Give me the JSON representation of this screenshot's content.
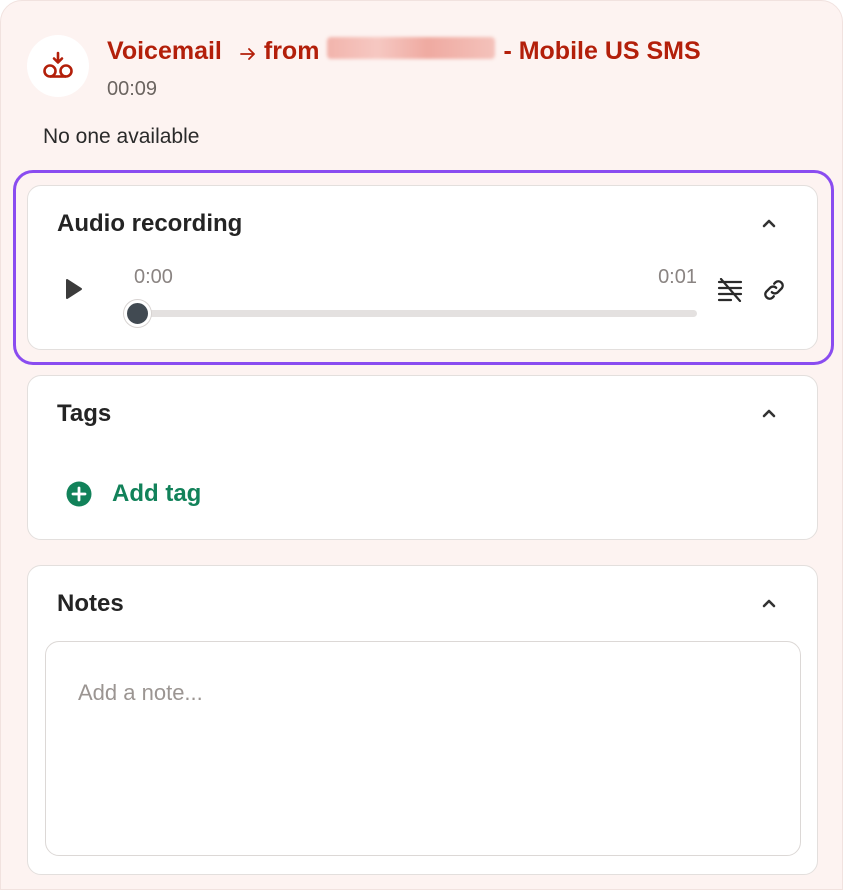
{
  "header": {
    "title": "Voicemail",
    "from_prefix": "from",
    "from_suffix": "- Mobile US SMS",
    "duration": "00:09",
    "status": "No one available"
  },
  "audio": {
    "title": "Audio recording",
    "current_time": "0:00",
    "total_time": "0:01",
    "progress_fraction": 0
  },
  "tags": {
    "title": "Tags",
    "add_label": "Add tag"
  },
  "notes": {
    "title": "Notes",
    "placeholder": "Add a note..."
  },
  "colors": {
    "accent_red": "#b31f0a",
    "highlight_purple": "#8a4cf0",
    "add_green": "#12825a"
  },
  "icons": {
    "voicemail": "voicemail-icon",
    "arrow": "arrow-right-icon",
    "play": "play-icon",
    "transcript": "transcript-off-icon",
    "link": "link-icon",
    "add": "plus-circle-icon",
    "collapse": "chevron-up-icon"
  }
}
